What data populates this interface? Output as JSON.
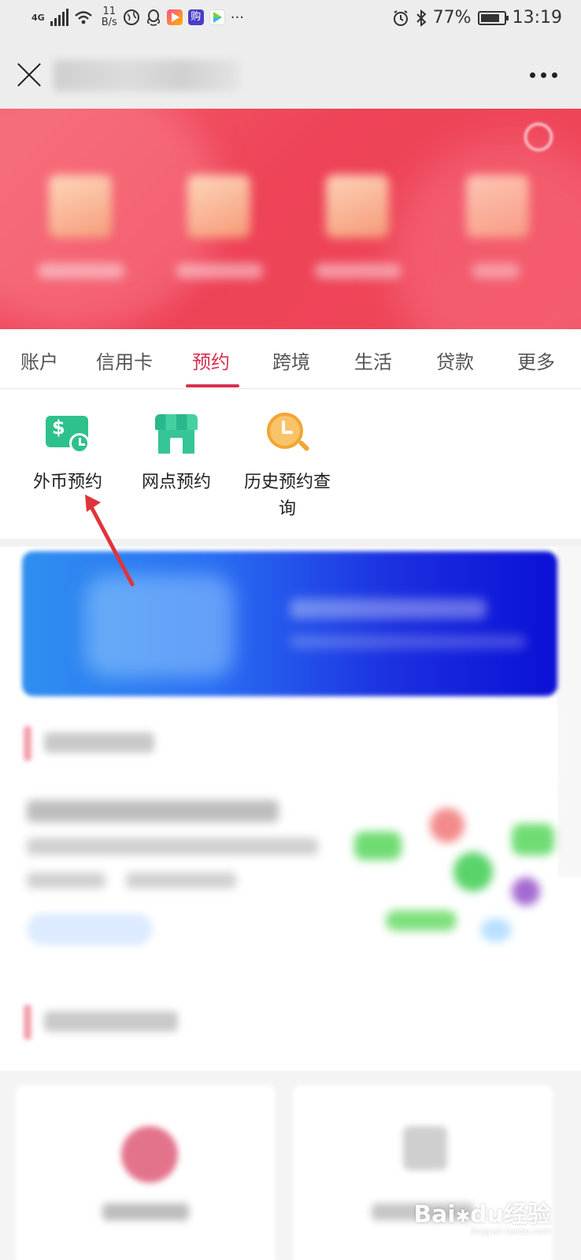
{
  "status_bar": {
    "network": "4G",
    "speed_value": "11",
    "speed_unit": "B/s",
    "battery_percent": "77%",
    "time": "13:19",
    "app_icons": [
      "globe-icon",
      "qq-icon",
      "video-app-icon",
      "shopping-app-icon",
      "play-app-icon"
    ],
    "overflow": "···"
  },
  "title_bar": {
    "close_icon": "close-icon",
    "more_icon": "more-icon"
  },
  "tabs": [
    {
      "label": "账户",
      "active": false
    },
    {
      "label": "信用卡",
      "active": false
    },
    {
      "label": "预约",
      "active": true
    },
    {
      "label": "跨境",
      "active": false
    },
    {
      "label": "生活",
      "active": false
    },
    {
      "label": "贷款",
      "active": false
    },
    {
      "label": "更多",
      "active": false
    }
  ],
  "services": [
    {
      "label": "外币预约",
      "icon": "foreign-currency-icon"
    },
    {
      "label": "网点预约",
      "icon": "branch-store-icon"
    },
    {
      "label": "历史预约查询",
      "icon": "history-search-icon"
    }
  ],
  "colors": {
    "accent": "#d9314e",
    "banner": "#ef4a5c",
    "fx_green": "#2fc18c",
    "history_orange": "#f3a532",
    "arrow": "#e0343a"
  },
  "watermark": {
    "brand": "Bai",
    "brand2": "du",
    "cn": "经验",
    "url": "jingyan.baidu.com"
  }
}
